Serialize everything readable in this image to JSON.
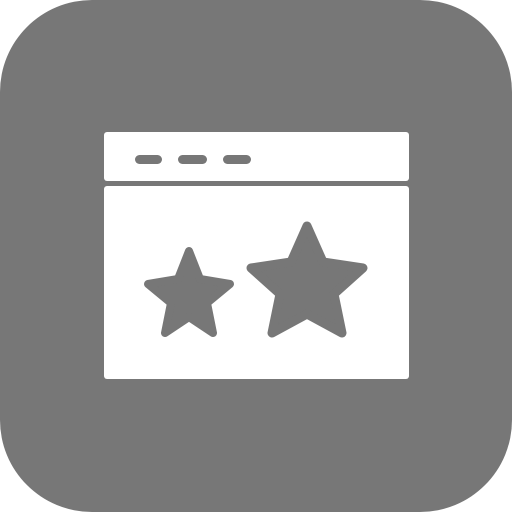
{
  "icon": {
    "depicts": "browser-window-with-two-stars",
    "colors": {
      "tile": "#777777",
      "glyph": "#ffffff"
    },
    "window_dot_count": 3,
    "star_count": 2
  }
}
